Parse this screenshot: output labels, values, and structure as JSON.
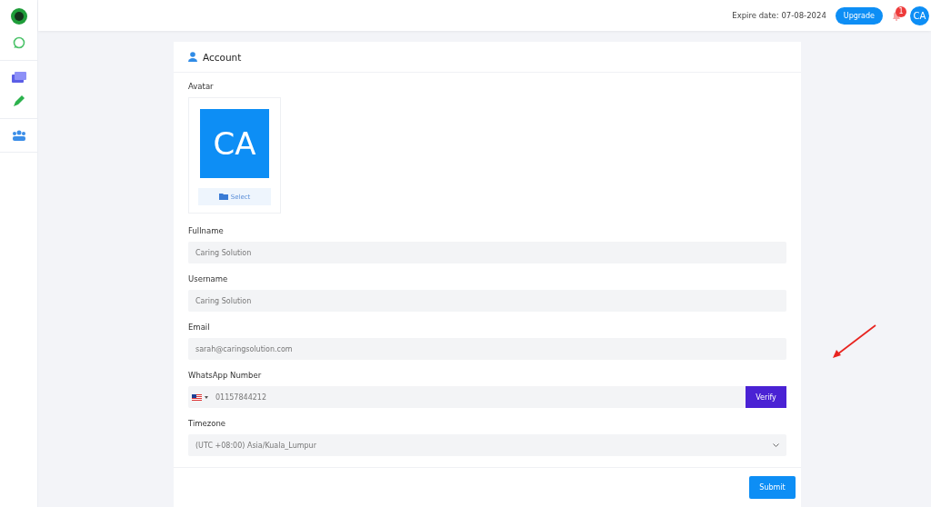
{
  "topbar": {
    "expire": "Expire date: 07-08-2024",
    "upgrade": "Upgrade",
    "notifications": "1",
    "avatar": "CA"
  },
  "card": {
    "title": "Account",
    "avatar_label": "Avatar",
    "avatar_initials": "CA",
    "select": "Select",
    "fields": [
      {
        "kind": "text",
        "label": "Fullname",
        "value": "Caring Solution"
      },
      {
        "kind": "text",
        "label": "Username",
        "value": "Caring Solution"
      },
      {
        "kind": "text",
        "label": "Email",
        "value": "sarah@caringsolution.com"
      },
      {
        "kind": "phone",
        "label": "WhatsApp Number",
        "value": "01157844212",
        "action": "Verify"
      },
      {
        "kind": "select",
        "label": "Timezone",
        "value": "(UTC +08:00) Asia/Kuala_Lumpur"
      }
    ],
    "submit": "Submit"
  }
}
